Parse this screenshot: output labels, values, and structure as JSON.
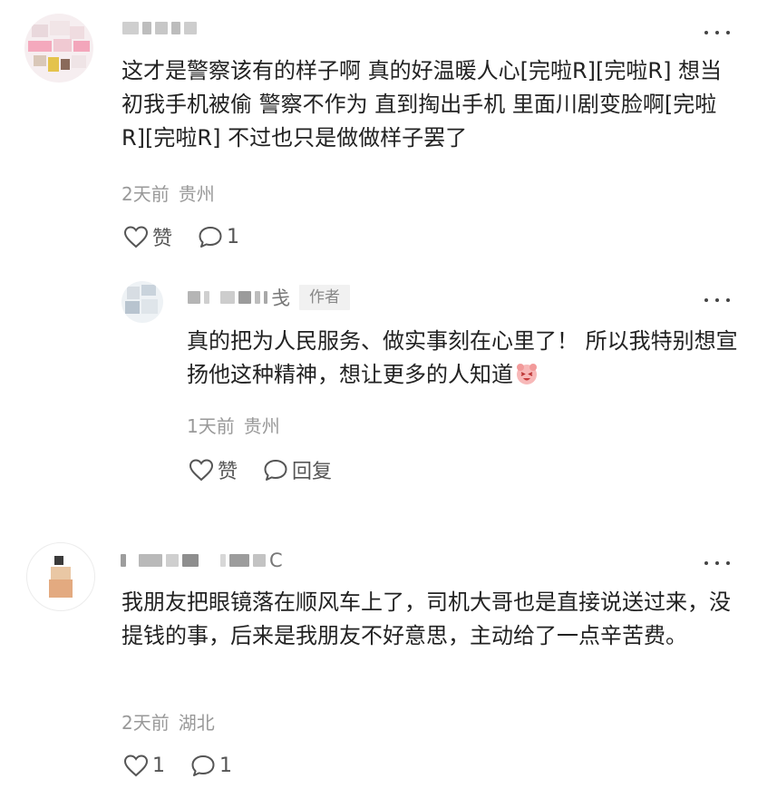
{
  "comments": [
    {
      "text": "这才是警察该有的样子啊 真的好温暖人心[完啦R][完啦R] 想当初我手机被偷 警察不作为 直到掏出手机 里面川剧变脸啊[完啦R][完啦R] 不过也只是做做样子罢了",
      "time": "2天前",
      "location": "贵州",
      "like_label": "赞",
      "reply_count": "1"
    },
    {
      "name_visible_char": "戋",
      "badge": "作者",
      "text": "真的把为人民服务、做实事刻在心里了！ 所以我特别想宣扬他这种精神，想让更多的人知道",
      "emoji": "laughing-face-emoji",
      "time": "1天前",
      "location": "贵州",
      "like_label": "赞",
      "reply_label": "回复"
    },
    {
      "name_visible_char": "C",
      "text": "我朋友把眼镜落在顺风车上了，司机大哥也是直接说送过来，没提钱的事，后来是我朋友不好意思，主动给了一点辛苦费。",
      "time": "2天前",
      "location": "湖北",
      "like_count": "1",
      "reply_count": "1"
    }
  ],
  "icons": {
    "like": "heart-outline-icon",
    "reply": "speech-bubble-icon",
    "more": "more-dots-icon"
  },
  "colors": {
    "text": "#222222",
    "meta": "#999999",
    "icon": "#555555"
  }
}
